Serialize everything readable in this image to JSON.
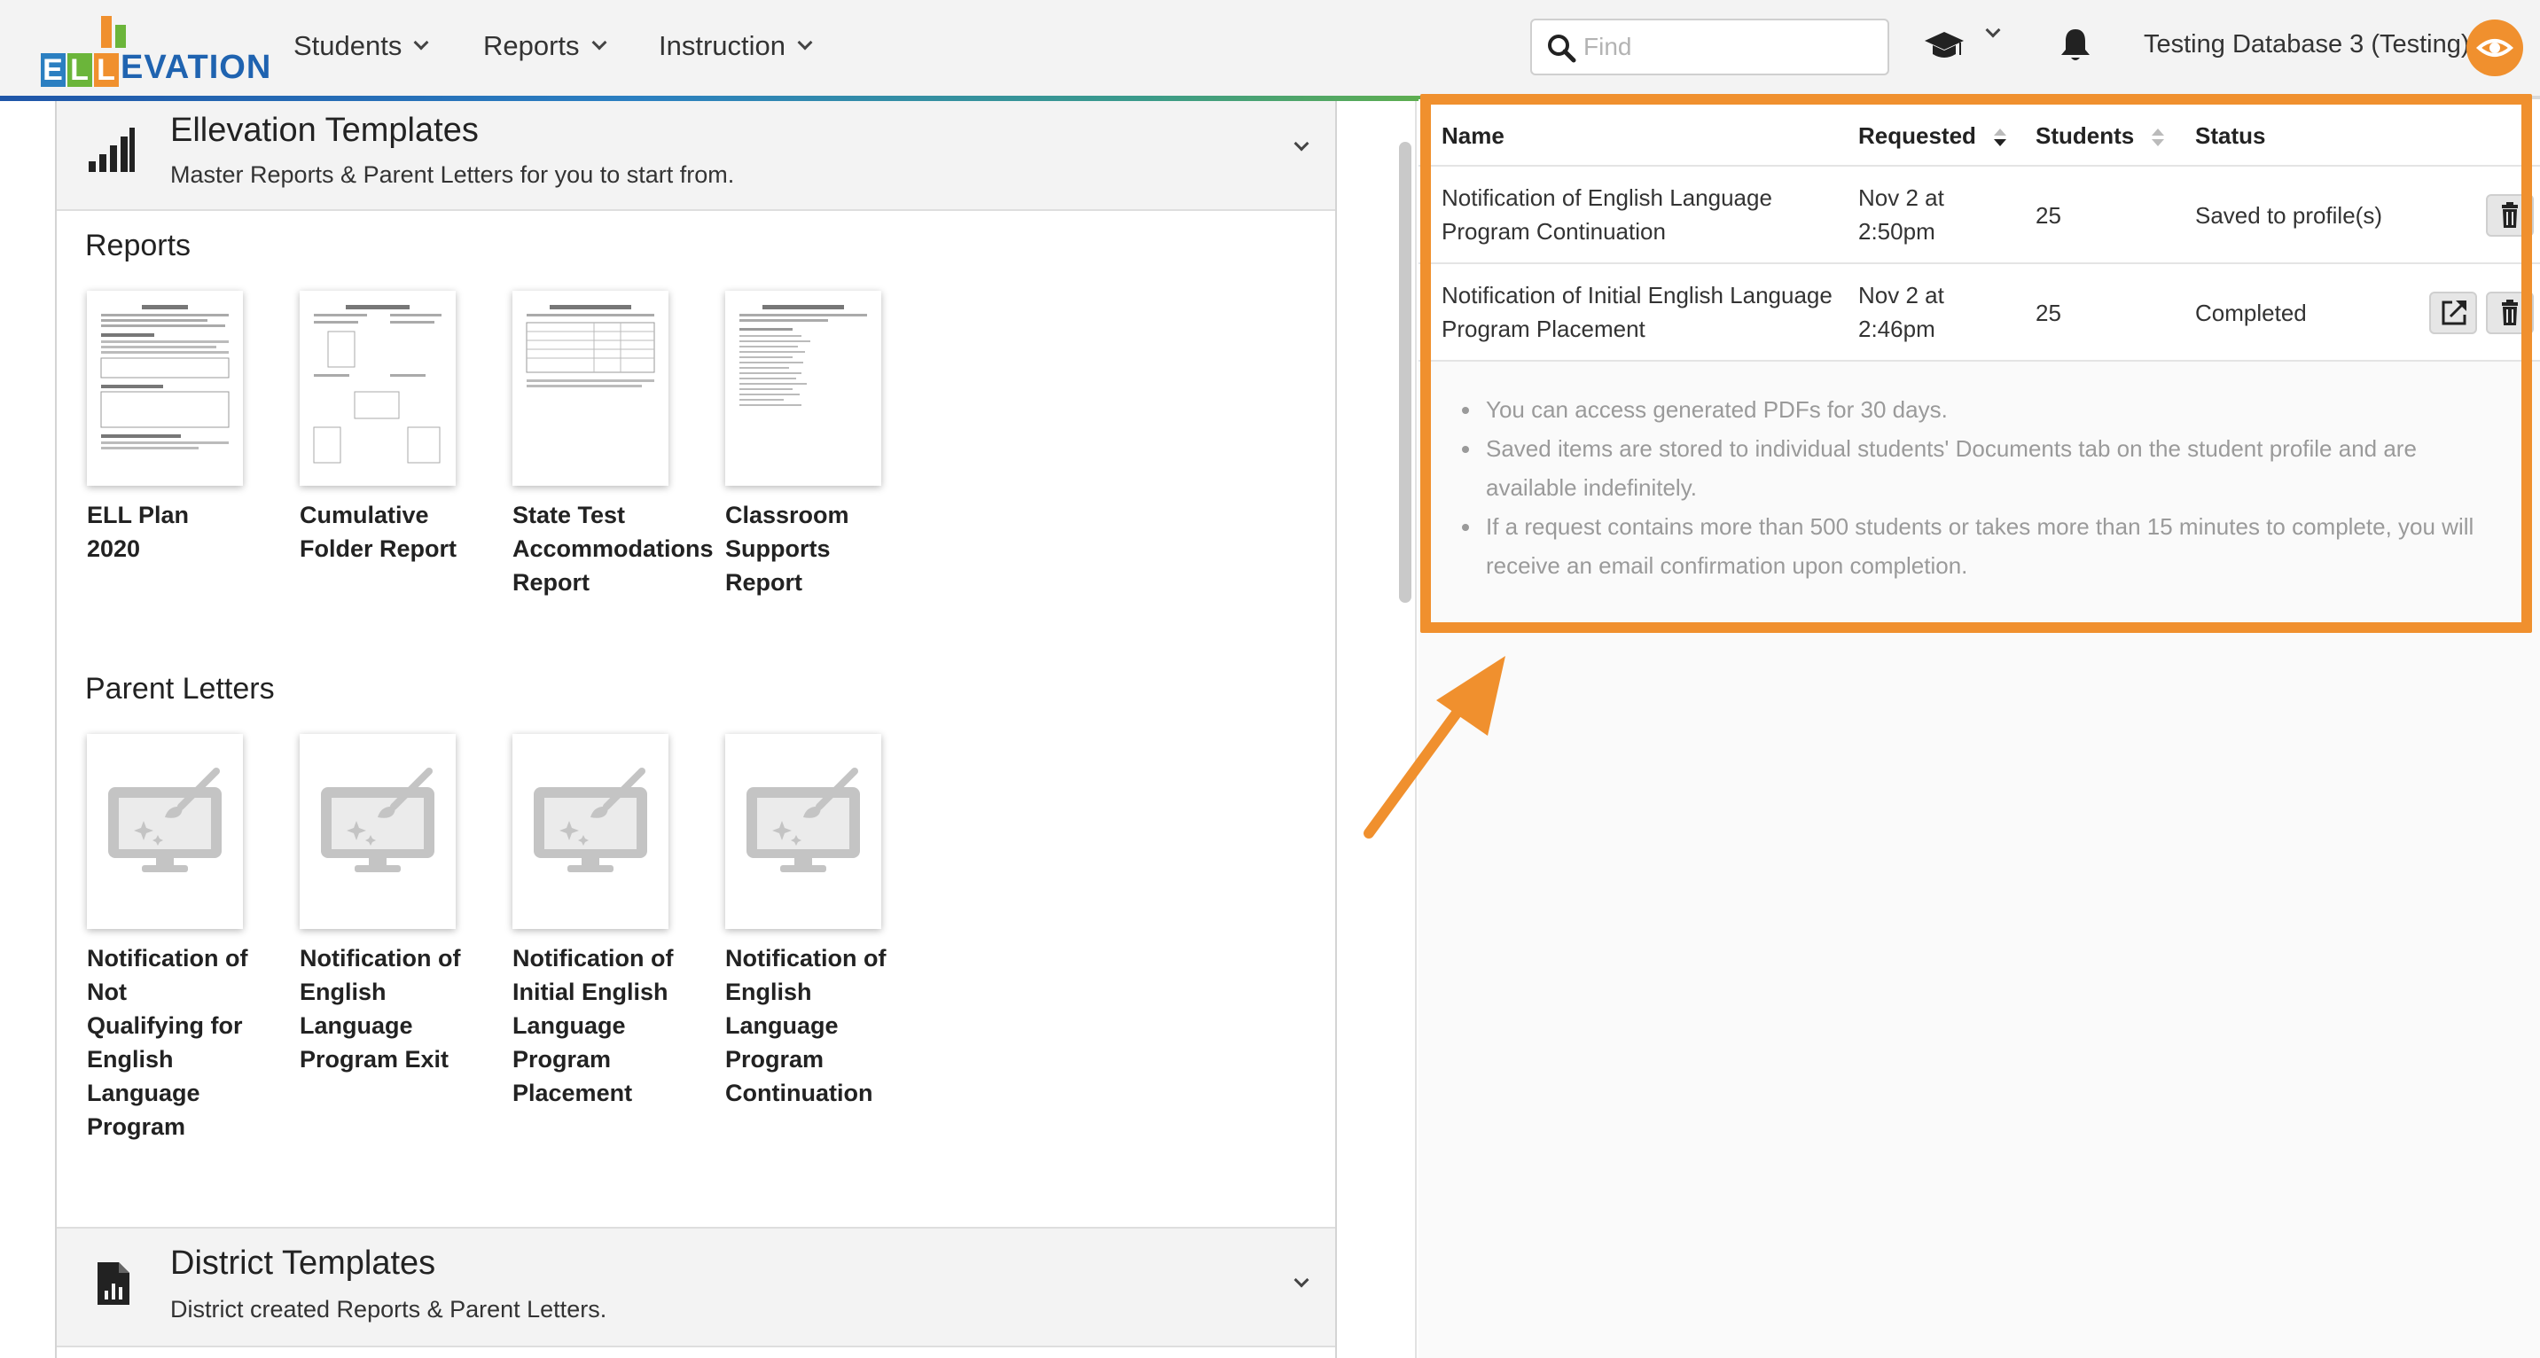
{
  "app": {
    "logo_text": "ELLEVATION",
    "brand_color": "#1f63b0",
    "accent_color": "#f0902e"
  },
  "nav": {
    "menus": [
      {
        "label": "Students"
      },
      {
        "label": "Reports"
      },
      {
        "label": "Instruction"
      }
    ],
    "search_placeholder": "Find",
    "search_value": "",
    "database_label": "Testing Database 3 (Testing)",
    "icons": [
      "search-icon",
      "graduation-cap-icon",
      "bell-icon",
      "eye-icon"
    ]
  },
  "ellevation_templates": {
    "title": "Ellevation Templates",
    "subtitle": "Master Reports & Parent Letters for you to start from.",
    "reports_heading": "Reports",
    "reports": [
      {
        "label_lines": [
          "ELL Plan",
          "2020"
        ]
      },
      {
        "label_lines": [
          "Cumulative",
          "Folder Report"
        ]
      },
      {
        "label_lines": [
          "State Test",
          "Accommodations",
          "Report"
        ]
      },
      {
        "label_lines": [
          "Classroom",
          "Supports",
          "Report"
        ]
      }
    ],
    "letters_heading": "Parent Letters",
    "letters": [
      {
        "label_lines": [
          "Notification of",
          "Not",
          "Qualifying for",
          "English",
          "Language",
          "Program"
        ]
      },
      {
        "label_lines": [
          "Notification of",
          "English",
          "Language",
          "Program Exit"
        ]
      },
      {
        "label_lines": [
          "Notification of",
          "Initial English",
          "Language",
          "Program",
          "Placement"
        ]
      },
      {
        "label_lines": [
          "Notification of",
          "English",
          "Language",
          "Program",
          "Continuation"
        ]
      }
    ]
  },
  "district_templates": {
    "title": "District Templates",
    "subtitle": "District created Reports & Parent Letters."
  },
  "requests_table": {
    "columns": [
      "Name",
      "Requested",
      "Students",
      "Status"
    ],
    "rows": [
      {
        "name_lines": [
          "Notification of English Language",
          "Program Continuation"
        ],
        "requested_lines": [
          "Nov 2 at",
          "2:50pm"
        ],
        "students": "25",
        "status": "Saved to profile(s)",
        "actions": [
          "delete"
        ]
      },
      {
        "name_lines": [
          "Notification of Initial English Language",
          "Program Placement"
        ],
        "requested_lines": [
          "Nov 2 at",
          "2:46pm"
        ],
        "students": "25",
        "status": "Completed",
        "actions": [
          "open",
          "delete"
        ]
      }
    ],
    "notes": [
      "You can access generated PDFs for 30 days.",
      "Saved items are stored to individual students' Documents tab on the student profile and are available indefinitely.",
      "If a request contains more than 500 students or takes more than 15 minutes to complete, you will receive an email confirmation upon completion."
    ]
  }
}
